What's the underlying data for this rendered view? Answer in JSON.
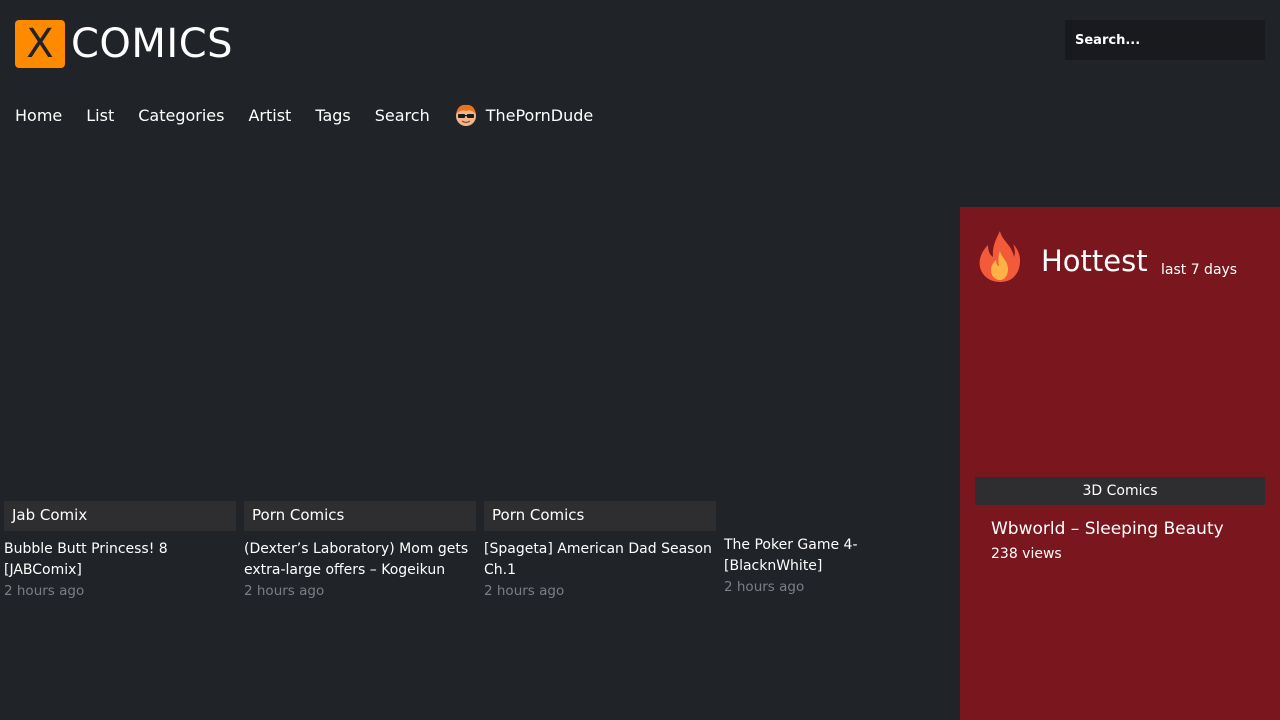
{
  "header": {
    "logo_mark": "X",
    "logo_text": "COMICS",
    "search_placeholder": "Search..."
  },
  "nav": {
    "items": [
      {
        "label": "Home"
      },
      {
        "label": "List"
      },
      {
        "label": "Categories"
      },
      {
        "label": "Artist"
      },
      {
        "label": "Tags"
      },
      {
        "label": "Search"
      },
      {
        "label": "ThePornDude",
        "icon": "porn-dude-avatar-icon"
      }
    ]
  },
  "cards": [
    {
      "category": "Jab Comix",
      "title": "Bubble Butt Princess! 8 [JABComix]",
      "time": "2 hours ago"
    },
    {
      "category": "Porn Comics",
      "title": "(Dexter’s Laboratory) Mom gets extra-large offers – Kogeikun",
      "time": "2 hours ago"
    },
    {
      "category": "Porn Comics",
      "title": "[Spageta] American Dad Season Ch.1",
      "time": "2 hours ago"
    },
    {
      "category": "",
      "title": "The Poker Game 4- [BlacknWhite]",
      "time": "2 hours ago"
    }
  ],
  "sidebar": {
    "icon": "flame-icon",
    "title": "Hottest",
    "subtitle": "last 7 days",
    "item": {
      "category": "3D Comics",
      "title": "Wbworld – Sleeping Beauty",
      "views": "238 views"
    }
  },
  "colors": {
    "background": "#202328",
    "accent": "#ff8a00",
    "sidebar": "#7a161d",
    "category_bg": "#2e2e31"
  }
}
